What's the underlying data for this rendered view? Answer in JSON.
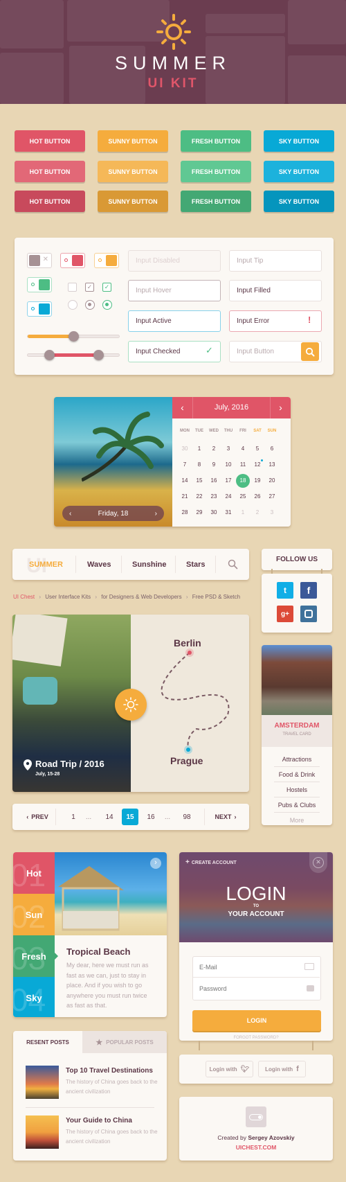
{
  "header": {
    "title": "SUMMER",
    "subtitle": "UI KIT",
    "logo_icon": "sun-icon"
  },
  "colors": {
    "hot": "#e05567",
    "sunny": "#f5ac3d",
    "fresh": "#4dbd84",
    "sky": "#08a9d6",
    "plum": "#5a3545",
    "bg": "#e8d6b4"
  },
  "buttons": {
    "rows": [
      [
        "HOT BUTTON",
        "SUNNY BUTTON",
        "FRESH BUTTON",
        "SKY BUTTON"
      ],
      [
        "HOT BUTTON",
        "SUNNY BUTTON",
        "FRESH BUTTON",
        "SKY BUTTON"
      ],
      [
        "HOT BUTTON",
        "SUNNY BUTTON",
        "FRESH BUTTON",
        "SKY BUTTON"
      ]
    ]
  },
  "controls": {
    "toggles": [
      {
        "state": "off",
        "color": "#a69194"
      },
      {
        "state": "on",
        "color": "#e05567"
      },
      {
        "state": "on",
        "color": "#f5ac3d"
      },
      {
        "state": "on",
        "color": "#4dbd84"
      },
      {
        "state": "on",
        "color": "#08a9d6"
      }
    ],
    "checkboxes": [
      {
        "checked": false
      },
      {
        "checked": true,
        "color": "#a69194"
      },
      {
        "checked": true,
        "color": "#4dbd84"
      }
    ],
    "radios": [
      {
        "selected": false
      },
      {
        "selected": true,
        "color": "#a69194"
      },
      {
        "selected": true,
        "color": "#4dbd84"
      }
    ],
    "slider_single": {
      "value": 0.5
    },
    "slider_range": {
      "low": 0.24,
      "high": 0.77
    },
    "inputs": {
      "disabled": "Input Disabled",
      "tip": "Input Tip",
      "hover": "Input Hover",
      "filled": "Input Filled",
      "active": "Input Active",
      "error": "Input Error",
      "checked": "Input Checked",
      "button": "Input Button"
    }
  },
  "calendar": {
    "month": "July, 2016",
    "photo_caption": "Friday, 18",
    "weekdays": [
      "MON",
      "TUE",
      "WED",
      "THU",
      "FRI",
      "SAT",
      "SUN"
    ],
    "weeks": [
      [
        "30",
        "1",
        "2",
        "3",
        "4",
        "5",
        "6"
      ],
      [
        "7",
        "8",
        "9",
        "10",
        "11",
        "12",
        "13"
      ],
      [
        "14",
        "15",
        "16",
        "17",
        "18",
        "19",
        "20"
      ],
      [
        "21",
        "22",
        "23",
        "24",
        "25",
        "26",
        "27"
      ],
      [
        "28",
        "29",
        "30",
        "31",
        "1",
        "2",
        "3"
      ]
    ],
    "selected": "18",
    "event_day": "12"
  },
  "nav": {
    "logo_ghost": "UI",
    "items": [
      "SUMMER",
      "Waves",
      "Sunshine",
      "Stars"
    ],
    "active": "SUMMER"
  },
  "breadcrumb": [
    "UI Chest",
    "User Interface Kits",
    "for Designers & Web Developers",
    "Free PSD & Sketch"
  ],
  "follow": {
    "title": "FOLLOW US",
    "networks": [
      "twitter",
      "facebook",
      "google-plus",
      "instagram"
    ]
  },
  "trip": {
    "title": "Road Trip / 2016",
    "dates": "July, 15-28",
    "from": "Berlin",
    "to": "Prague"
  },
  "amsterdam": {
    "city": "AMSTERDAM",
    "subtitle": "TRAVEL CARD",
    "items": [
      "Attractions",
      "Food & Drink",
      "Hostels",
      "Pubs & Clubs"
    ],
    "more": "More"
  },
  "pagination": {
    "prev": "PREV",
    "next": "NEXT",
    "pages": [
      "1",
      "...",
      "14",
      "15",
      "16",
      "...",
      "98"
    ],
    "current": "15"
  },
  "tabs_card": {
    "tabs": [
      {
        "num": "01",
        "label": "Hot"
      },
      {
        "num": "02",
        "label": "Sun"
      },
      {
        "num": "03",
        "label": "Fresh"
      },
      {
        "num": "04",
        "label": "Sky"
      }
    ],
    "active": "Fresh",
    "title": "Tropical Beach",
    "body": "My dear, here we must run as fast as we can, just to stay in place. And if you wish to go anywhere you must run twice as fast as that."
  },
  "login": {
    "create": "CREATE ACCOUNT",
    "title": "LOGIN",
    "to": "TO",
    "subtitle": "YOUR ACCOUNT",
    "email_placeholder": "E-Mail",
    "password_placeholder": "Password",
    "button": "LOGIN",
    "forgot": "FORGOT PASSWORD?",
    "social": [
      "Login with",
      "Login with"
    ]
  },
  "posts": {
    "tabs": [
      "RESENT POSTS",
      "POPULAR POSTS"
    ],
    "items": [
      {
        "title": "Top 10 Travel Destinations",
        "desc": "The history of China goes back to the ancient civilization"
      },
      {
        "title": "Your Guide to China",
        "desc": "The history of China goes back to the ancient civilization"
      }
    ]
  },
  "credits": {
    "created_by": "Created by",
    "author": "Sergey Azovskiy",
    "site": "UICHEST.COM"
  }
}
